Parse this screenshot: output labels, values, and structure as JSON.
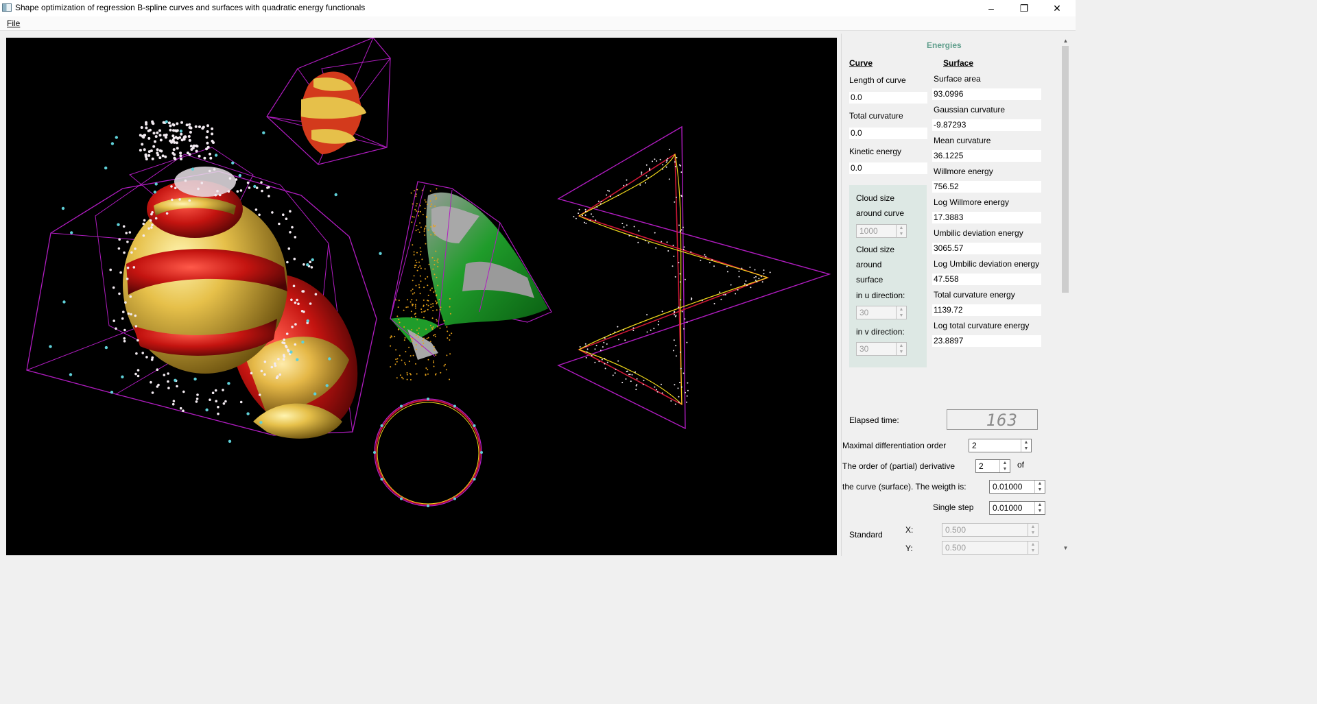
{
  "window": {
    "title": "Shape optimization of regression B-spline curves and surfaces with quadratic energy functionals",
    "minimize_icon": "minimize-icon",
    "restore_icon": "restore-icon",
    "close_icon": "close-icon"
  },
  "menu": {
    "file": "File"
  },
  "panel": {
    "section_title": "Energies",
    "curve_header": "Curve",
    "surface_header": "Surface",
    "curve": {
      "length_label": "Length of curve",
      "length_value": "0.0",
      "total_curvature_label": "Total curvature",
      "total_curvature_value": "0.0",
      "kinetic_label": "Kinetic energy",
      "kinetic_value": "0.0"
    },
    "surface": {
      "area_label": "Surface area",
      "area_value": "93.0996",
      "gaussian_label": "Gaussian curvature",
      "gaussian_value": "-9.87293",
      "mean_label": "Mean curvature",
      "mean_value": "36.1225",
      "willmore_label": "Willmore energy",
      "willmore_value": "756.52",
      "log_willmore_label": "Log Willmore energy",
      "log_willmore_value": "17.3883",
      "umbilic_label": "Umbilic deviation energy",
      "umbilic_value": "3065.57",
      "log_umbilic_label": "Log Umbilic deviation energy",
      "log_umbilic_value": "47.558",
      "total_curv_label": "Total curvature energy",
      "total_curv_value": "1139.72",
      "log_total_curv_label": "Log total curvature energy",
      "log_total_curv_value": "23.8897"
    },
    "cloud": {
      "curve_line1": "Cloud size",
      "curve_line2": "around curve",
      "curve_value": "1000",
      "surface_line1": "Cloud size",
      "surface_line2": "around",
      "surface_line3": "surface",
      "u_label": "in u direction:",
      "u_value": "30",
      "v_label": "in v direction:",
      "v_value": "30"
    },
    "elapsed_label": "Elapsed time:",
    "elapsed_value": "163",
    "max_order_label": "Maximal differentiation order",
    "max_order_value": "2",
    "derivative_label": "The order of (partial) derivative",
    "derivative_value": "2",
    "of_label": "of",
    "weight_label": "the curve (surface). The weigth is:",
    "weight_value": "0.01000",
    "single_step_label": "Single step",
    "single_step_value": "0.01000",
    "standard_label": "Standard",
    "x_label": "X:",
    "x_value": "0.500",
    "y_label": "Y:",
    "y_value": "0.500"
  },
  "colors": {
    "viewport_bg": "#000000",
    "control_net": "#b01cc0",
    "section_title": "#5f9e8c",
    "cloud_box": "#dde8e4"
  }
}
